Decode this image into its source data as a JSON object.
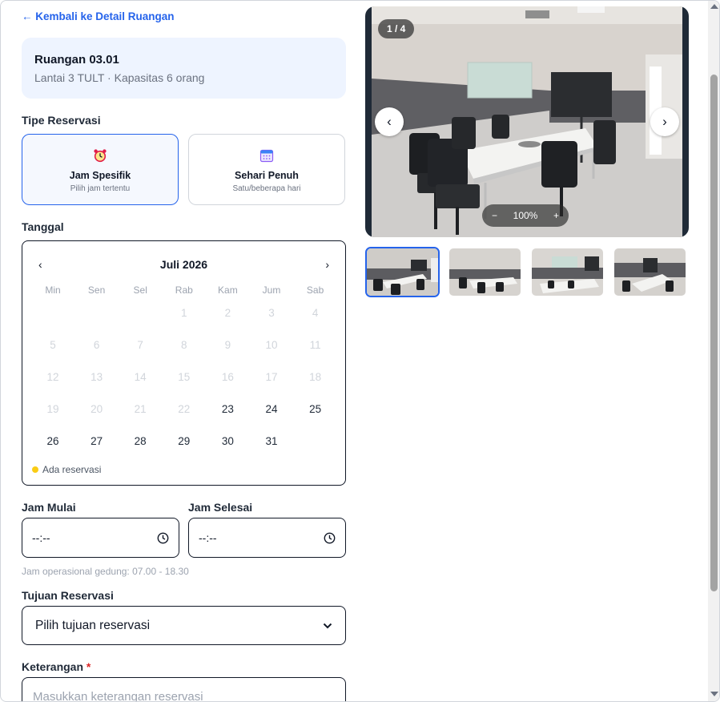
{
  "back_link": "← Kembali ke Detail Ruangan",
  "room": {
    "name": "Ruangan 03.01",
    "subtitle": "Lantai 3 TULT · Kapasitas 6 orang"
  },
  "reservation_type": {
    "label": "Tipe Reservasi",
    "options": [
      {
        "title": "Jam Spesifik",
        "subtitle": "Pilih jam tertentu",
        "icon": "alarm-clock-icon",
        "selected": true
      },
      {
        "title": "Sehari Penuh",
        "subtitle": "Satu/beberapa hari",
        "icon": "calendar-icon",
        "selected": false
      }
    ]
  },
  "date": {
    "label": "Tanggal",
    "calendar": {
      "month_label": "Juli 2026",
      "prev": "‹",
      "next": "›",
      "weekdays": [
        "Min",
        "Sen",
        "Sel",
        "Rab",
        "Kam",
        "Jum",
        "Sab"
      ],
      "days": [
        [
          "",
          "",
          "",
          "1",
          "2",
          "3",
          "4"
        ],
        [
          "5",
          "6",
          "7",
          "8",
          "9",
          "10",
          "11"
        ],
        [
          "12",
          "13",
          "14",
          "15",
          "16",
          "17",
          "18"
        ],
        [
          "19",
          "20",
          "21",
          "22",
          "23",
          "24",
          "25"
        ],
        [
          "26",
          "27",
          "28",
          "29",
          "30",
          "31",
          ""
        ]
      ],
      "first_enabled_day": 23,
      "legend": "Ada reservasi",
      "legend_color": "#facc15"
    }
  },
  "time": {
    "start_label": "Jam Mulai",
    "end_label": "Jam Selesai",
    "start_value": "--:--",
    "end_value": "--:--",
    "hint": "Jam operasional gedung: 07.00 - 18.30"
  },
  "purpose": {
    "label": "Tujuan Reservasi",
    "selected": "Pilih tujuan reservasi"
  },
  "notes": {
    "label": "Keterangan",
    "required_mark": "*",
    "placeholder": "Masukkan keterangan reservasi"
  },
  "gallery": {
    "counter": "1 / 4",
    "zoom": "100%",
    "zoom_out": "−",
    "zoom_in": "+",
    "prev": "‹",
    "next": "›",
    "active_thumb": 0,
    "thumb_count": 4
  },
  "colors": {
    "accent": "#2563eb",
    "selected_bg": "#f5f8fe",
    "room_card_bg": "#eef4ff"
  }
}
